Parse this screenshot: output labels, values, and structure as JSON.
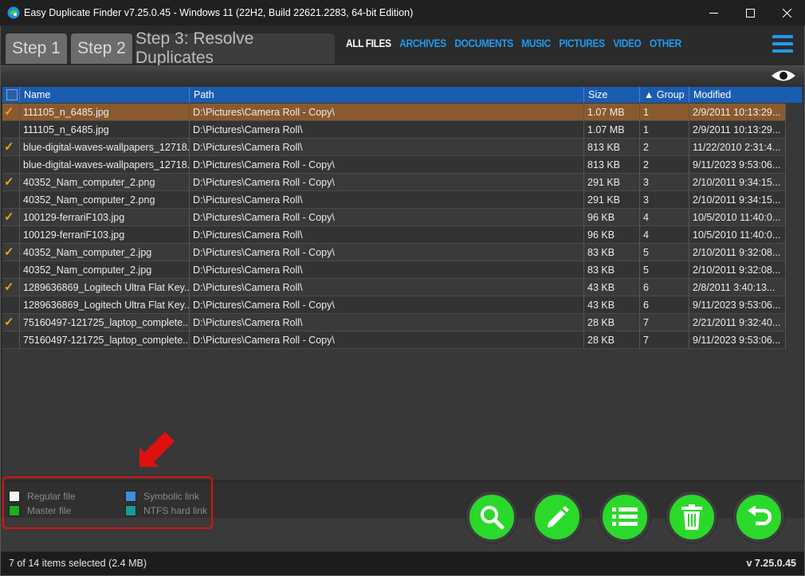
{
  "window": {
    "title": "Easy Duplicate Finder v7.25.0.45 - Windows 11 (22H2, Build 22621.2283, 64-bit Edition)"
  },
  "tabs": [
    {
      "label": "Step 1"
    },
    {
      "label": "Step 2"
    },
    {
      "label": "Step 3: Resolve Duplicates"
    }
  ],
  "filters": [
    "ALL FILES",
    "ARCHIVES",
    "DOCUMENTS",
    "MUSIC",
    "PICTURES",
    "VIDEO",
    "OTHER"
  ],
  "columns": {
    "name": "Name",
    "path": "Path",
    "size": "Size",
    "group": "Group",
    "group_sort_glyph": "▲",
    "modified": "Modified"
  },
  "rows": [
    {
      "checked": true,
      "name": "111105_n_6485.jpg",
      "path": "D:\\Pictures\\Camera Roll - Copy\\",
      "size": "1.07 MB",
      "group": "1",
      "modified": "2/9/2011 10:13:29..."
    },
    {
      "checked": false,
      "name": "111105_n_6485.jpg",
      "path": "D:\\Pictures\\Camera Roll\\",
      "size": "1.07 MB",
      "group": "1",
      "modified": "2/9/2011 10:13:29..."
    },
    {
      "checked": true,
      "name": "blue-digital-waves-wallpapers_12718...",
      "path": "D:\\Pictures\\Camera Roll\\",
      "size": "813 KB",
      "group": "2",
      "modified": "11/22/2010 2:31:4..."
    },
    {
      "checked": false,
      "name": "blue-digital-waves-wallpapers_12718...",
      "path": "D:\\Pictures\\Camera Roll - Copy\\",
      "size": "813 KB",
      "group": "2",
      "modified": "9/11/2023 9:53:06..."
    },
    {
      "checked": true,
      "name": "40352_Nam_computer_2.png",
      "path": "D:\\Pictures\\Camera Roll - Copy\\",
      "size": "291 KB",
      "group": "3",
      "modified": "2/10/2011 9:34:15..."
    },
    {
      "checked": false,
      "name": "40352_Nam_computer_2.png",
      "path": "D:\\Pictures\\Camera Roll\\",
      "size": "291 KB",
      "group": "3",
      "modified": "2/10/2011 9:34:15..."
    },
    {
      "checked": true,
      "name": "100129-ferrariF103.jpg",
      "path": "D:\\Pictures\\Camera Roll - Copy\\",
      "size": "96 KB",
      "group": "4",
      "modified": "10/5/2010 11:40:0..."
    },
    {
      "checked": false,
      "name": "100129-ferrariF103.jpg",
      "path": "D:\\Pictures\\Camera Roll\\",
      "size": "96 KB",
      "group": "4",
      "modified": "10/5/2010 11:40:0..."
    },
    {
      "checked": true,
      "name": "40352_Nam_computer_2.jpg",
      "path": "D:\\Pictures\\Camera Roll - Copy\\",
      "size": "83 KB",
      "group": "5",
      "modified": "2/10/2011 9:32:08..."
    },
    {
      "checked": false,
      "name": "40352_Nam_computer_2.jpg",
      "path": "D:\\Pictures\\Camera Roll\\",
      "size": "83 KB",
      "group": "5",
      "modified": "2/10/2011 9:32:08..."
    },
    {
      "checked": true,
      "name": "1289636869_Logitech Ultra Flat Key...",
      "path": "D:\\Pictures\\Camera Roll\\",
      "size": "43 KB",
      "group": "6",
      "modified": "2/8/2011 3:40:13..."
    },
    {
      "checked": false,
      "name": "1289636869_Logitech Ultra Flat Key...",
      "path": "D:\\Pictures\\Camera Roll - Copy\\",
      "size": "43 KB",
      "group": "6",
      "modified": "9/11/2023 9:53:06..."
    },
    {
      "checked": true,
      "name": "75160497-121725_laptop_complete...",
      "path": "D:\\Pictures\\Camera Roll\\",
      "size": "28 KB",
      "group": "7",
      "modified": "2/21/2011 9:32:40..."
    },
    {
      "checked": false,
      "name": "75160497-121725_laptop_complete...",
      "path": "D:\\Pictures\\Camera Roll - Copy\\",
      "size": "28 KB",
      "group": "7",
      "modified": "9/11/2023 9:53:06..."
    }
  ],
  "selected_row_index": 0,
  "check_glyph": "✓",
  "legend": [
    {
      "label": "Regular file",
      "color": "#f2f2f2"
    },
    {
      "label": "Master file",
      "color": "#1fae1f"
    },
    {
      "label": "Symbolic link",
      "color": "#3d8fd8"
    },
    {
      "label": "NTFS hard link",
      "color": "#1a9a9a"
    }
  ],
  "actions": [
    {
      "name": "search-button",
      "icon": "search-icon"
    },
    {
      "name": "edit-button",
      "icon": "pencil-icon"
    },
    {
      "name": "list-button",
      "icon": "list-icon"
    },
    {
      "name": "delete-button",
      "icon": "trash-icon"
    },
    {
      "name": "undo-button",
      "icon": "undo-icon"
    }
  ],
  "colors": {
    "accent": "#1e9bf0",
    "action_green": "#2bd92b",
    "selected_row": "#8a5a2e",
    "header_blue": "#1a5cb0",
    "annotation_red": "#e01010"
  },
  "status": {
    "selection": "7 of 14 items selected (2.4 MB)",
    "version": "v 7.25.0.45"
  }
}
